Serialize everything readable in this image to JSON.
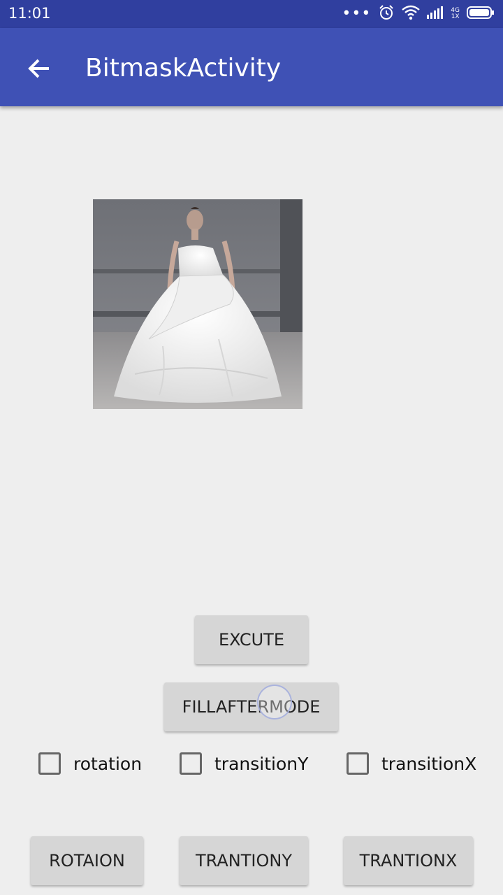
{
  "status_bar": {
    "time": "11:01",
    "network_top": "4G",
    "network_bottom": "1X",
    "icons": [
      "more-dots-icon",
      "alarm-icon",
      "wifi-icon",
      "signal-icon",
      "battery-icon"
    ]
  },
  "app_bar": {
    "title": "BitmaskActivity",
    "back_icon": "arrow-back-icon",
    "color": "#3f51b5",
    "status_color": "#303f9f"
  },
  "image": {
    "description_icon": "bride-photo"
  },
  "buttons": {
    "excute": "EXCUTE",
    "fillaftermode": "FILLAFTERMODE",
    "rotaion": "ROTAION",
    "trantiony": "TRANTIONY",
    "trantionx": "TRANTIONX"
  },
  "checkboxes": [
    {
      "label": "rotation",
      "checked": false
    },
    {
      "label": "transitionY",
      "checked": false
    },
    {
      "label": "transitionX",
      "checked": false
    }
  ]
}
